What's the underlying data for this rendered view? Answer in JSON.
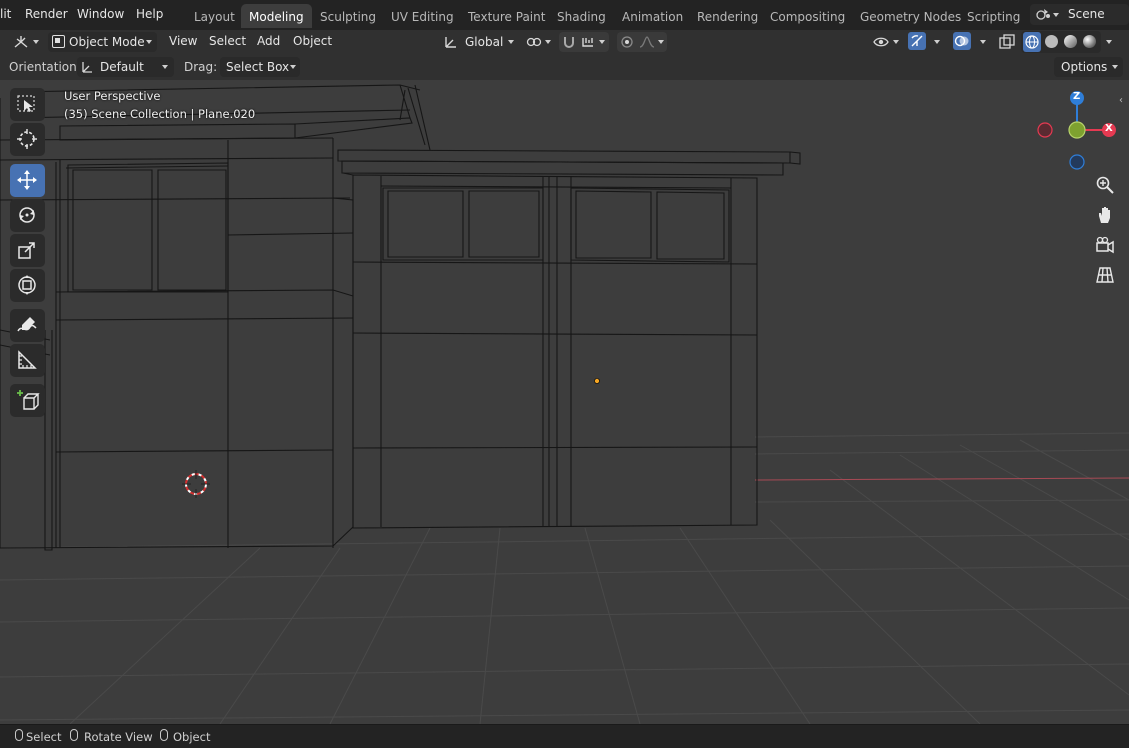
{
  "menubar": {
    "items": [
      "lit",
      "Render",
      "Window",
      "Help"
    ]
  },
  "workspaces": {
    "tabs": [
      "Layout",
      "Modeling",
      "Sculpting",
      "UV Editing",
      "Texture Paint",
      "Shading",
      "Animation",
      "Rendering",
      "Compositing",
      "Geometry Nodes",
      "Scripting"
    ],
    "active": "Modeling"
  },
  "scene": {
    "label": "Scene"
  },
  "header": {
    "mode": "Object Mode",
    "menus": [
      "View",
      "Select",
      "Add",
      "Object"
    ],
    "transform_orientation": "Global"
  },
  "tool_settings": {
    "orientation_label": "Orientation:",
    "orientation_value": "Default",
    "drag_label": "Drag:",
    "drag_value": "Select Box",
    "options_label": "Options"
  },
  "viewport": {
    "view_name": "User Perspective",
    "collection_info": "(35) Scene Collection | Plane.020"
  },
  "gizmo": {
    "z": "Z",
    "x": "X"
  },
  "statusbar": {
    "select": "Select",
    "rotate": "Rotate View",
    "object": "Object"
  },
  "colors": {
    "accent": "#4772b3",
    "x_axis": "#e63a52",
    "y_axis": "#7ea12f",
    "z_axis": "#2f7ed8",
    "origin": "#f5a623"
  },
  "icons": [
    "cursor-select-icon",
    "3d-cursor-icon",
    "move-icon",
    "rotate-icon",
    "scale-icon",
    "transform-icon",
    "annotate-icon",
    "measure-icon",
    "add-cube-icon",
    "zoom-icon",
    "hand-icon",
    "camera-icon",
    "grid-icon"
  ]
}
